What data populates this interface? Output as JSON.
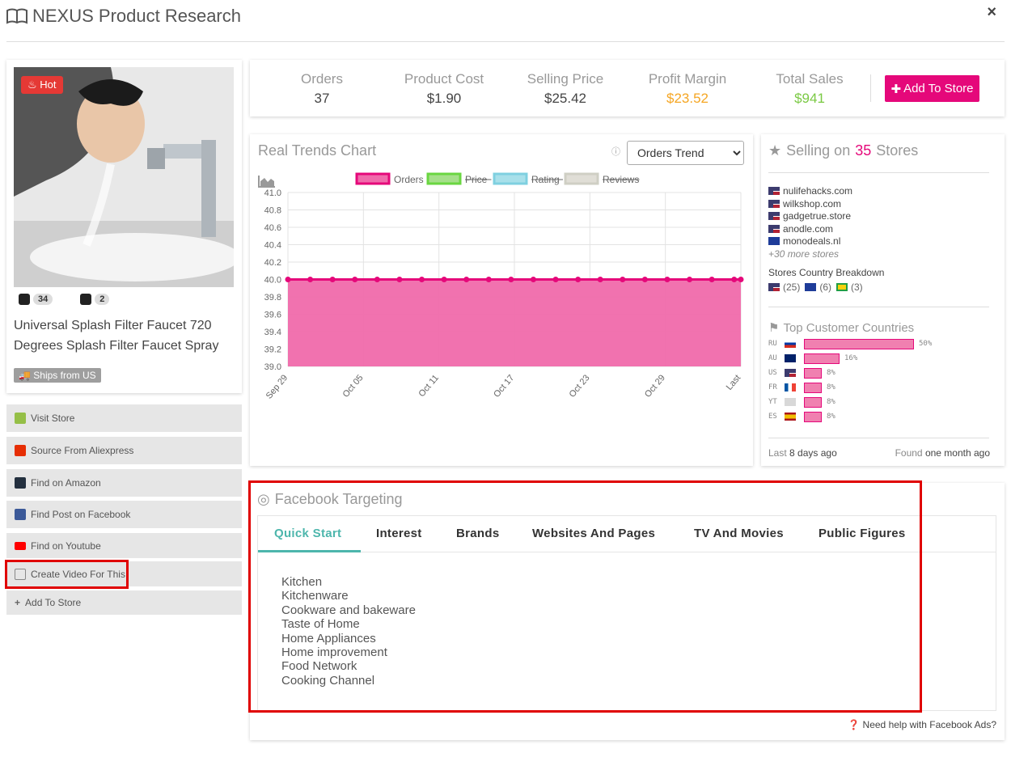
{
  "window": {
    "title": "NEXUS Product Research",
    "close": "×"
  },
  "product": {
    "hot_label": "Hot",
    "shopify_count": "34",
    "ali_count": "2",
    "title": "Universal Splash Filter Faucet 720 Degrees Splash Filter Faucet Spray",
    "ships": "Ships from US"
  },
  "side_buttons": [
    {
      "label": "Visit Store",
      "icon": "shopify-icon",
      "color": "#95bf47"
    },
    {
      "label": "Source From Aliexpress",
      "icon": "aliexpress-icon",
      "color": "#e62e04"
    },
    {
      "label": "Find on Amazon",
      "icon": "amazon-icon",
      "color": "#232f3e"
    },
    {
      "label": "Find Post on Facebook",
      "icon": "facebook-icon",
      "color": "#3b5998"
    },
    {
      "label": "Find on Youtube",
      "icon": "youtube-icon",
      "color": "#ff0000"
    },
    {
      "label": "Create Video For This",
      "icon": "film-icon",
      "color": "#888888"
    },
    {
      "label": "Add To Store",
      "icon": "plus-icon",
      "color": "#666666"
    }
  ],
  "stats": {
    "orders": {
      "label": "Orders",
      "value": "37"
    },
    "cost": {
      "label": "Product Cost",
      "value": "$1.90"
    },
    "price": {
      "label": "Selling Price",
      "value": "$25.42"
    },
    "margin": {
      "label": "Profit Margin",
      "value": "$23.52",
      "color": "#f5a623"
    },
    "sales": {
      "label": "Total Sales",
      "value": "$941",
      "color": "#7ac943"
    },
    "add_button": "Add To Store",
    "accent": "#e5087a"
  },
  "chart_panel": {
    "title": "Real Trends Chart",
    "info": "ⓘ",
    "select_value": "Orders Trend"
  },
  "chart_data": {
    "type": "line",
    "legend": [
      {
        "name": "Orders",
        "color": "#e5087a",
        "fill": "#f06aab",
        "hidden": false
      },
      {
        "name": "Price",
        "color": "#6ad641",
        "fill": "#a5e08a",
        "hidden": true
      },
      {
        "name": "Rating",
        "color": "#7fd0e0",
        "fill": "#a8e0ea",
        "hidden": true
      },
      {
        "name": "Reviews",
        "color": "#cfcfc4",
        "fill": "#e0ded6",
        "hidden": true
      }
    ],
    "x_ticks": [
      "Sep 29",
      "Oct 05",
      "Oct 11",
      "Oct 17",
      "Oct 23",
      "Oct 29",
      "Last"
    ],
    "y_ticks": [
      "41.0",
      "40.8",
      "40.6",
      "40.4",
      "40.2",
      "40.0",
      "39.8",
      "39.6",
      "39.4",
      "39.2",
      "39.0"
    ],
    "ylim": [
      39.0,
      41.0
    ],
    "series": [
      {
        "name": "Orders",
        "values": [
          40,
          40,
          40,
          40,
          40,
          40,
          40,
          40,
          40,
          40,
          40,
          40,
          40,
          40,
          40,
          40,
          40,
          40,
          40,
          40,
          40,
          40,
          40,
          40,
          40,
          40,
          40,
          40,
          40,
          40,
          40,
          40,
          40,
          40,
          40,
          40,
          40,
          40,
          40,
          40,
          40,
          40,
          40,
          40,
          40,
          40,
          40,
          40,
          40,
          40,
          40,
          40,
          40,
          40,
          40,
          40,
          40,
          40,
          40,
          40,
          40,
          40,
          40,
          40,
          40,
          40,
          40,
          40,
          40,
          40,
          40,
          40,
          40,
          40,
          40,
          40,
          40,
          40,
          40,
          40,
          40,
          40,
          40,
          40,
          40,
          40,
          40,
          40,
          40,
          40,
          40,
          40,
          40,
          40,
          40,
          40,
          40,
          40,
          40,
          40,
          40,
          40,
          40,
          40,
          40,
          40,
          40,
          40,
          40,
          40,
          40,
          40,
          40,
          40,
          40,
          40,
          40,
          40,
          40,
          40,
          40,
          40,
          40,
          40,
          40,
          40,
          40,
          40,
          40,
          40,
          40,
          40,
          40,
          40,
          40,
          40,
          40,
          40,
          40,
          40,
          40,
          40,
          40,
          40,
          40,
          40,
          40,
          40,
          40,
          40,
          40,
          40,
          40,
          40,
          40,
          40,
          40,
          40,
          40,
          40,
          40,
          40,
          40,
          40,
          40,
          40,
          40,
          40,
          40,
          40,
          40,
          40,
          40,
          40,
          40,
          40,
          40,
          40,
          40,
          40,
          40,
          40,
          40,
          40,
          40,
          40,
          40,
          40,
          40,
          40,
          40,
          40,
          40,
          40,
          40,
          40,
          40,
          40,
          40,
          40,
          40,
          40,
          40,
          40
        ]
      }
    ],
    "grid": true
  },
  "stores": {
    "prefix": "Selling on",
    "count": "35",
    "suffix": "Stores",
    "list": [
      {
        "name": "nulifehacks.com",
        "flag": "us"
      },
      {
        "name": "wilkshop.com",
        "flag": "us"
      },
      {
        "name": "gadgetrue.store",
        "flag": "us"
      },
      {
        "name": "anodle.com",
        "flag": "us"
      },
      {
        "name": "monodeals.nl",
        "flag": "eu"
      }
    ],
    "more": "+30 more stores",
    "breakdown_title": "Stores Country Breakdown",
    "breakdown": [
      {
        "flag": "us",
        "count": "(25)"
      },
      {
        "flag": "eu",
        "count": "(6)"
      },
      {
        "flag": "br",
        "count": "(3)"
      }
    ],
    "top_title": "Top Customer Countries",
    "countries": [
      {
        "code": "RU",
        "flag": "ru",
        "pct": 50,
        "label": "50%"
      },
      {
        "code": "AU",
        "flag": "au",
        "pct": 16,
        "label": "16%"
      },
      {
        "code": "US",
        "flag": "us",
        "pct": 8,
        "label": "8%"
      },
      {
        "code": "FR",
        "flag": "fr",
        "pct": 8,
        "label": "8%"
      },
      {
        "code": "YT",
        "flag": "yt",
        "pct": 8,
        "label": "8%"
      },
      {
        "code": "ES",
        "flag": "es",
        "pct": 8,
        "label": "8%"
      }
    ],
    "last_label": "Last",
    "last_value": "8 days ago",
    "found_label": "Found",
    "found_value": "one month ago"
  },
  "facebook": {
    "title": "Facebook Targeting",
    "tabs": [
      "Quick Start",
      "Interest",
      "Brands",
      "Websites And Pages",
      "TV And Movies",
      "Public Figures"
    ],
    "interests": [
      "Kitchen",
      "Kitchenware",
      "Cookware and bakeware",
      "Taste of Home",
      "Home Appliances",
      "Home improvement",
      "Food Network",
      "Cooking Channel"
    ],
    "help": "Need help with Facebook Ads?",
    "tab_color": "#4db6ac"
  }
}
